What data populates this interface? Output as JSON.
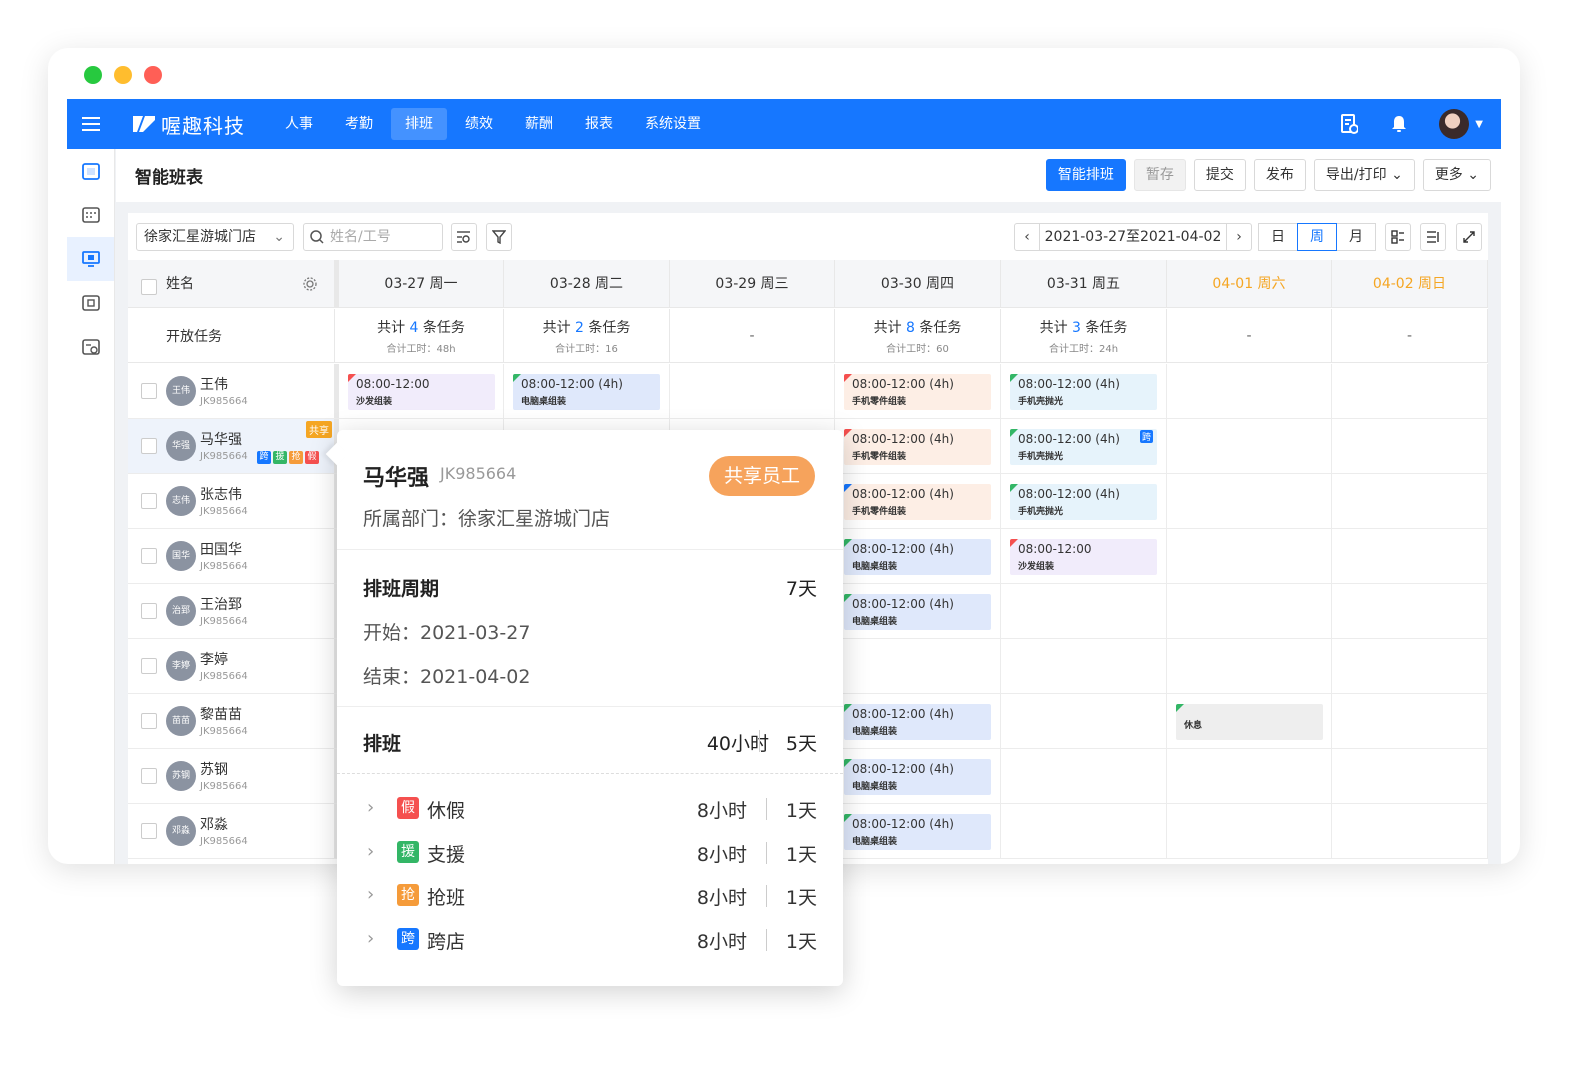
{
  "app": {
    "brand": "喔趣科技",
    "nav": [
      "人事",
      "考勤",
      "排班",
      "绩效",
      "薪酬",
      "报表",
      "系统设置"
    ],
    "active_nav": "排班"
  },
  "page": {
    "title": "智能班表",
    "actions": {
      "smart": "智能排班",
      "save": "暂存",
      "submit": "提交",
      "publish": "发布",
      "export": "导出/打印",
      "more": "更多"
    }
  },
  "filters": {
    "store": "徐家汇星游城门店",
    "search_placeholder": "姓名/工号",
    "date_range": "2021-03-27至2021-04-02",
    "views": [
      "日",
      "周",
      "月"
    ],
    "active_view": "周"
  },
  "grid": {
    "name_header": "姓名",
    "columns": [
      {
        "label": "03-27  周一",
        "weekend": false
      },
      {
        "label": "03-28  周二",
        "weekend": false
      },
      {
        "label": "03-29  周三",
        "weekend": false
      },
      {
        "label": "03-30  周四",
        "weekend": false
      },
      {
        "label": "03-31  周五",
        "weekend": false
      },
      {
        "label": "04-01  周六",
        "weekend": true
      },
      {
        "label": "04-02  周日",
        "weekend": true
      }
    ],
    "open_tasks": {
      "label": "开放任务",
      "prefix": "共计",
      "suffix": "条任务",
      "cells": [
        {
          "count": "4",
          "hours": "合计工时：48h"
        },
        {
          "count": "2",
          "hours": "合计工时：16"
        },
        {
          "dash": "-"
        },
        {
          "count": "8",
          "hours": "合计工时：60"
        },
        {
          "count": "3",
          "hours": "合计工时：24h"
        },
        {
          "dash": "-"
        },
        {
          "dash": "-"
        }
      ]
    },
    "employees": [
      {
        "name": "王伟",
        "avatar": "王伟",
        "id": "JK985664"
      },
      {
        "name": "马华强",
        "avatar": "华强",
        "id": "JK985664",
        "share": "共享",
        "tags": [
          "跨",
          "援",
          "抢",
          "假"
        ]
      },
      {
        "name": "张志伟",
        "avatar": "志伟",
        "id": "JK985664"
      },
      {
        "name": "田国华",
        "avatar": "国华",
        "id": "JK985664"
      },
      {
        "name": "王治郅",
        "avatar": "治郅",
        "id": "JK985664"
      },
      {
        "name": "李婷",
        "avatar": "李婷",
        "id": "JK985664"
      },
      {
        "name": "黎苗苗",
        "avatar": "苗苗",
        "id": "JK985664"
      },
      {
        "name": "苏钢",
        "avatar": "苏钢",
        "id": "JK985664"
      },
      {
        "name": "邓淼",
        "avatar": "邓淼",
        "id": "JK985664"
      }
    ],
    "shifts": {
      "r0c0": {
        "time": "08:00-12:00",
        "task": "沙发组装"
      },
      "r0c1": {
        "time": "08:00-12:00  (4h)",
        "task": "电脑桌组装"
      },
      "r0c3": {
        "time": "08:00-12:00  (4h)",
        "task": "手机零件组装"
      },
      "r0c4": {
        "time": "08:00-12:00  (4h)",
        "task": "手机壳抛光"
      },
      "r1c3": {
        "time": "08:00-12:00  (4h)",
        "task": "手机零件组装"
      },
      "r1c4": {
        "time": "08:00-12:00  (4h)",
        "task": "手机壳抛光",
        "badge": "跨"
      },
      "r2c3": {
        "time": "08:00-12:00  (4h)",
        "task": "手机零件组装"
      },
      "r2c4": {
        "time": "08:00-12:00  (4h)",
        "task": "手机壳抛光"
      },
      "r3c3": {
        "time": "08:00-12:00  (4h)",
        "task": "电脑桌组装"
      },
      "r3c4": {
        "time": "08:00-12:00",
        "task": "沙发组装"
      },
      "r4c3": {
        "time": "08:00-12:00  (4h)",
        "task": "电脑桌组装"
      },
      "r6c3": {
        "time": "08:00-12:00  (4h)",
        "task": "电脑桌组装"
      },
      "r6c5": {
        "rest": "休息"
      },
      "r7c3": {
        "time": "08:00-12:00  (4h)",
        "task": "电脑桌组装"
      },
      "r8c3": {
        "time": "08:00-12:00  (4h)",
        "task": "电脑桌组装"
      }
    }
  },
  "popup": {
    "name": "马华强",
    "id": "JK985664",
    "badge": "共享员工",
    "dept": "所属部门：徐家汇星游城门店",
    "period_title": "排班周期",
    "period_days": "7天",
    "start": "开始：2021-03-27",
    "end": "结束：2021-04-02",
    "schedule_title": "排班",
    "schedule_hours": "40小时",
    "schedule_days": "5天",
    "items": [
      {
        "icon": "假",
        "label": "休假",
        "hours": "8小时",
        "days": "1天",
        "color": "#f5504f"
      },
      {
        "icon": "援",
        "label": "支援",
        "hours": "8小时",
        "days": "1天",
        "color": "#33b666"
      },
      {
        "icon": "抢",
        "label": "抢班",
        "hours": "8小时",
        "days": "1天",
        "color": "#f59b3a"
      },
      {
        "icon": "跨",
        "label": "跨店",
        "hours": "8小时",
        "days": "1天",
        "color": "#1677ff"
      }
    ]
  },
  "colors": {
    "primary": "#1677ff",
    "weekend": "#f5a623"
  }
}
